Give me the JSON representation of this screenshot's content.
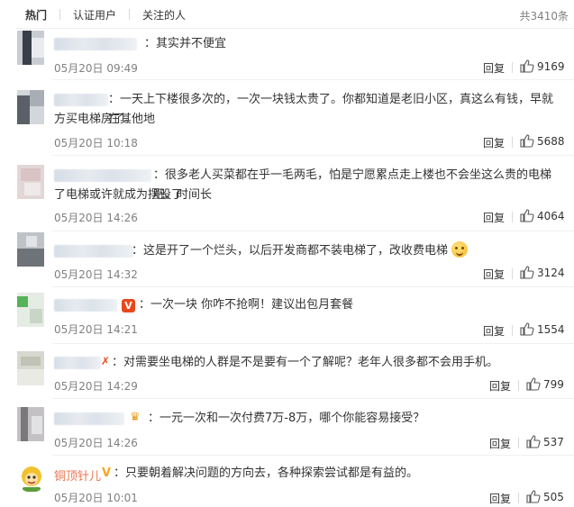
{
  "tabs": [
    {
      "label": "热门",
      "active": true
    },
    {
      "label": "认证用户",
      "active": false
    },
    {
      "label": "关注的人",
      "active": false
    }
  ],
  "total": "共3410条",
  "reply_label": "回复",
  "comments": [
    {
      "user": "",
      "text": "：其实并不便宜",
      "time": "05月20日 09:49",
      "likes": "9169"
    },
    {
      "user": "",
      "text_line1": "：一天上下楼很多次的，一次一块钱太贵了。你都知道是老旧小区，真这么有钱，早就在其他地",
      "text_line2": "方买电梯房了。",
      "time": "05月20日 10:18",
      "likes": "5688"
    },
    {
      "user": "",
      "text_line1": "：很多老人买菜都在乎一毛两毛，怕是宁愿累点走上楼也不会坐这么贵的电梯吧。时间长",
      "text_line2": "了电梯或许就成为摆设了",
      "time": "05月20日 14:26",
      "likes": "4064"
    },
    {
      "user": "",
      "text": "：这是开了一个烂头，以后开发商都不装电梯了，改收费电梯",
      "time": "05月20日 14:32",
      "likes": "3124"
    },
    {
      "user": "",
      "text": "：一次一块 你咋不抢啊！建议出包月套餐",
      "time": "05月20日 14:21",
      "likes": "1554",
      "badge": "V"
    },
    {
      "user": "",
      "text": "：对需要坐电梯的人群是不是要有一个了解呢？老年人很多都不会用手机。",
      "time": "05月20日 14:29",
      "likes": "799"
    },
    {
      "user": "",
      "text": "：一元一次和一次付费7万-8万，哪个你能容易接受？",
      "time": "05月20日 14:26",
      "likes": "537"
    },
    {
      "user": "铜顶针儿",
      "text": "：只要朝着解决问题的方向去，各种探索尝试都是有益的。",
      "time": "05月20日 10:01",
      "likes": "505",
      "badge": "V"
    }
  ]
}
